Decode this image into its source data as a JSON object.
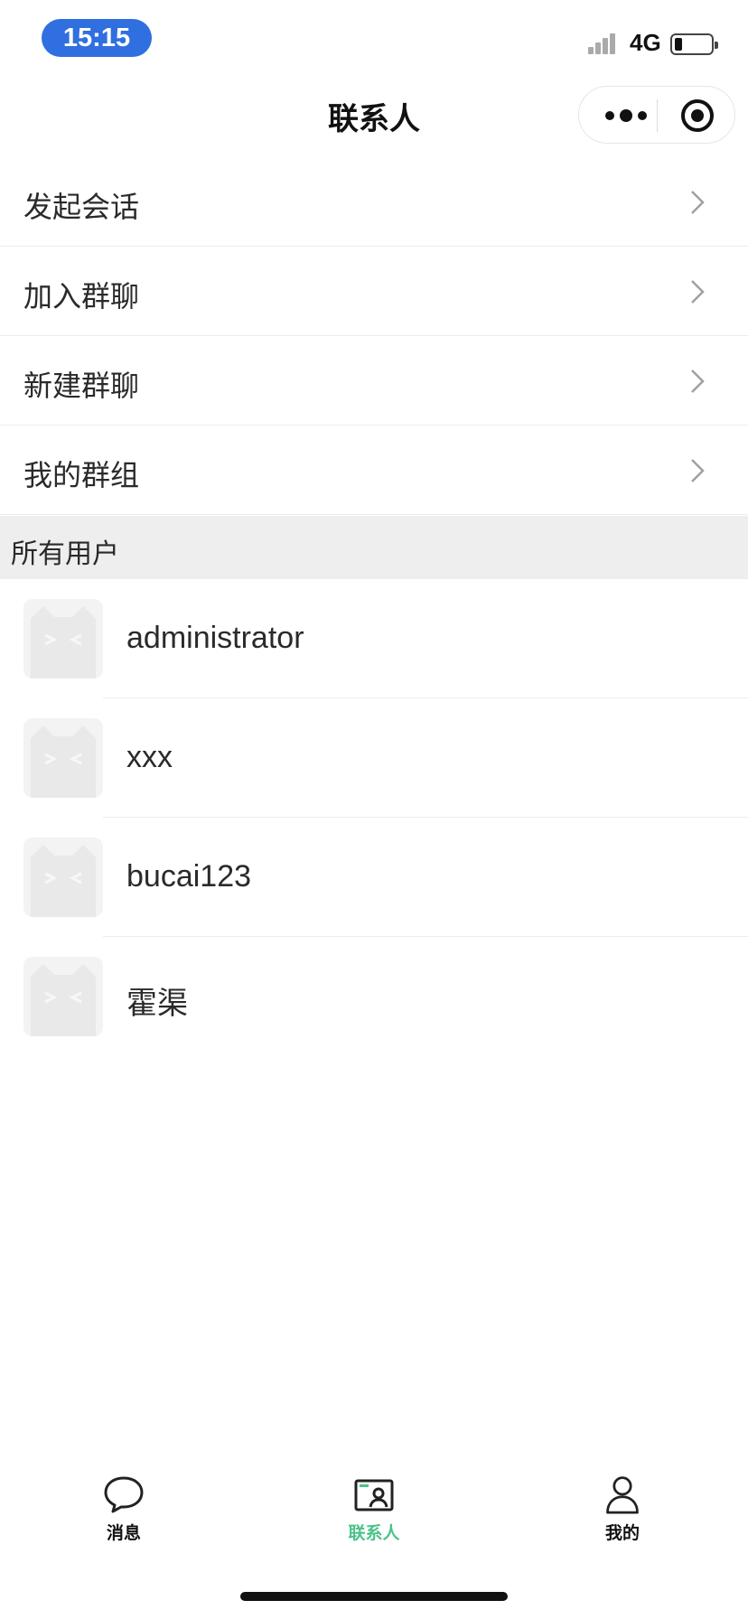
{
  "status_bar": {
    "time": "15:15",
    "network": "4G"
  },
  "nav": {
    "title": "联系人",
    "capsule_icons": [
      "more-dots-icon",
      "target-icon"
    ]
  },
  "menu": {
    "items": [
      {
        "label": "发起会话",
        "icon": "chevron-right-icon"
      },
      {
        "label": "加入群聊",
        "icon": "chevron-right-icon"
      },
      {
        "label": "新建群聊",
        "icon": "chevron-right-icon"
      },
      {
        "label": "我的群组",
        "icon": "chevron-right-icon"
      }
    ]
  },
  "section": {
    "title": "所有用户"
  },
  "users": [
    {
      "name": "administrator",
      "avatar": "cat-avatar"
    },
    {
      "name": "xxx",
      "avatar": "cat-avatar"
    },
    {
      "name": "bucai123",
      "avatar": "cat-avatar"
    },
    {
      "name": "霍渠",
      "avatar": "cat-avatar"
    }
  ],
  "tabbar": {
    "active_color": "#4cc28a",
    "items": [
      {
        "label": "消息",
        "icon": "chat-bubble-icon"
      },
      {
        "label": "联系人",
        "icon": "contact-card-icon",
        "active": true
      },
      {
        "label": "我的",
        "icon": "person-icon"
      }
    ]
  }
}
